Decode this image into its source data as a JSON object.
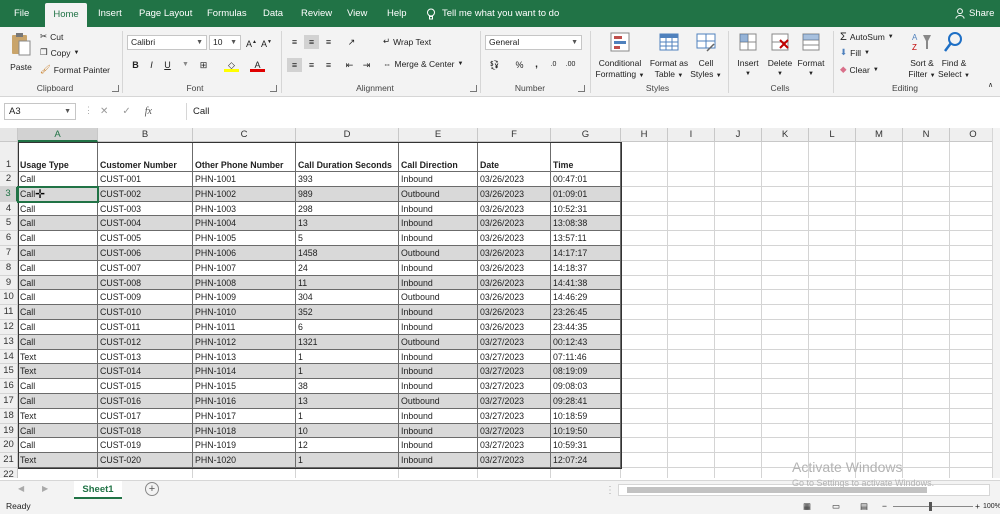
{
  "menu": {
    "tabs": [
      "File",
      "Home",
      "Insert",
      "Page Layout",
      "Formulas",
      "Data",
      "Review",
      "View",
      "Help"
    ],
    "active_tab": "Home",
    "tell_me": "Tell me what you want to do",
    "share": "Share"
  },
  "ribbon": {
    "clipboard": {
      "paste": "Paste",
      "cut": "Cut",
      "copy": "Copy",
      "format_painter": "Format Painter",
      "label": "Clipboard"
    },
    "font": {
      "name": "Calibri",
      "size": "10",
      "bold": "B",
      "italic": "I",
      "underline": "U",
      "label": "Font"
    },
    "alignment": {
      "wrap_text": "Wrap Text",
      "merge_center": "Merge & Center",
      "label": "Alignment"
    },
    "number": {
      "format": "General",
      "label": "Number"
    },
    "styles": {
      "conditional": [
        "Conditional",
        "Formatting"
      ],
      "format_table": [
        "Format as",
        "Table"
      ],
      "cell_styles": [
        "Cell",
        "Styles"
      ],
      "label": "Styles"
    },
    "cells": {
      "insert": "Insert",
      "delete": "Delete",
      "format": "Format",
      "label": "Cells"
    },
    "editing": {
      "autosum": "AutoSum",
      "fill": "Fill",
      "clear": "Clear",
      "sort_filter": [
        "Sort &",
        "Filter"
      ],
      "find_select": [
        "Find &",
        "Select"
      ],
      "label": "Editing"
    }
  },
  "formula_bar": {
    "name_box": "A3",
    "fx": "fx",
    "content": "Call"
  },
  "grid": {
    "columns": [
      "A",
      "B",
      "C",
      "D",
      "E",
      "F",
      "G",
      "H",
      "I",
      "J",
      "K",
      "L",
      "M",
      "N",
      "O"
    ],
    "rows": [
      "1",
      "2",
      "3",
      "4",
      "5",
      "6",
      "7",
      "8",
      "9",
      "10",
      "11",
      "12",
      "13",
      "14",
      "15",
      "16",
      "17",
      "18",
      "19",
      "20",
      "21",
      "22"
    ],
    "selected_cell": "A3",
    "headers": [
      "Usage Type",
      "Customer Number",
      "Other Phone Number",
      "Call Duration Seconds",
      "Call Direction",
      "Date",
      "Time"
    ],
    "data": [
      [
        "Call",
        "CUST-001",
        "PHN-1001",
        "393",
        "Inbound",
        "03/26/2023",
        "00:47:01"
      ],
      [
        "Call",
        "CUST-002",
        "PHN-1002",
        "989",
        "Outbound",
        "03/26/2023",
        "01:09:01"
      ],
      [
        "Call",
        "CUST-003",
        "PHN-1003",
        "298",
        "Inbound",
        "03/26/2023",
        "10:52:31"
      ],
      [
        "Call",
        "CUST-004",
        "PHN-1004",
        "13",
        "Inbound",
        "03/26/2023",
        "13:08:38"
      ],
      [
        "Call",
        "CUST-005",
        "PHN-1005",
        "5",
        "Inbound",
        "03/26/2023",
        "13:57:11"
      ],
      [
        "Call",
        "CUST-006",
        "PHN-1006",
        "1458",
        "Outbound",
        "03/26/2023",
        "14:17:17"
      ],
      [
        "Call",
        "CUST-007",
        "PHN-1007",
        "24",
        "Inbound",
        "03/26/2023",
        "14:18:37"
      ],
      [
        "Call",
        "CUST-008",
        "PHN-1008",
        "11",
        "Inbound",
        "03/26/2023",
        "14:41:38"
      ],
      [
        "Call",
        "CUST-009",
        "PHN-1009",
        "304",
        "Outbound",
        "03/26/2023",
        "14:46:29"
      ],
      [
        "Call",
        "CUST-010",
        "PHN-1010",
        "352",
        "Inbound",
        "03/26/2023",
        "23:26:45"
      ],
      [
        "Call",
        "CUST-011",
        "PHN-1011",
        "6",
        "Inbound",
        "03/26/2023",
        "23:44:35"
      ],
      [
        "Call",
        "CUST-012",
        "PHN-1012",
        "1321",
        "Outbound",
        "03/27/2023",
        "00:12:43"
      ],
      [
        "Text",
        "CUST-013",
        "PHN-1013",
        "1",
        "Inbound",
        "03/27/2023",
        "07:11:46"
      ],
      [
        "Text",
        "CUST-014",
        "PHN-1014",
        "1",
        "Inbound",
        "03/27/2023",
        "08:19:09"
      ],
      [
        "Call",
        "CUST-015",
        "PHN-1015",
        "38",
        "Inbound",
        "03/27/2023",
        "09:08:03"
      ],
      [
        "Call",
        "CUST-016",
        "PHN-1016",
        "13",
        "Outbound",
        "03/27/2023",
        "09:28:41"
      ],
      [
        "Text",
        "CUST-017",
        "PHN-1017",
        "1",
        "Inbound",
        "03/27/2023",
        "10:18:59"
      ],
      [
        "Call",
        "CUST-018",
        "PHN-1018",
        "10",
        "Inbound",
        "03/27/2023",
        "10:19:50"
      ],
      [
        "Call",
        "CUST-019",
        "PHN-1019",
        "12",
        "Inbound",
        "03/27/2023",
        "10:59:31"
      ],
      [
        "Text",
        "CUST-020",
        "PHN-1020",
        "1",
        "Inbound",
        "03/27/2023",
        "12:07:24"
      ]
    ]
  },
  "sheets": {
    "tabs": [
      "Sheet1"
    ],
    "add": "+"
  },
  "status": {
    "ready": "Ready",
    "zoom": "100%"
  },
  "watermark": {
    "line1": "Activate Windows",
    "line2": "Go to Settings to activate Windows."
  },
  "colors": {
    "accent": "#217346",
    "shade": "#d9d9d9"
  }
}
